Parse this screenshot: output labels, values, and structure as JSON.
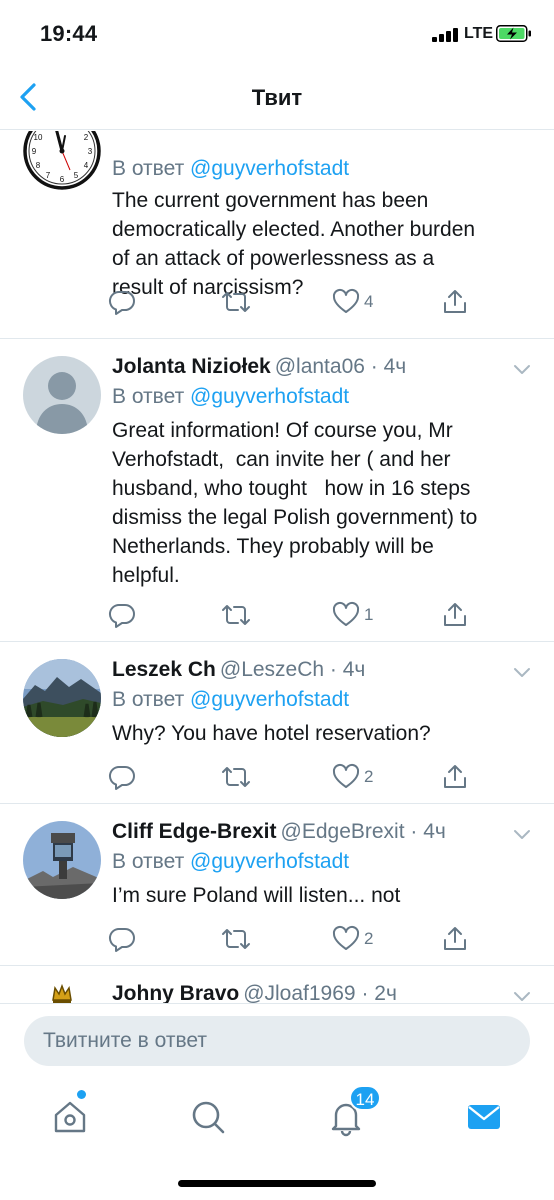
{
  "status_bar": {
    "time": "19:44",
    "network": "LTE"
  },
  "nav": {
    "title": "Твит"
  },
  "replying_prefix": "В ответ",
  "tweets": [
    {
      "name": "",
      "handle": "",
      "time": "",
      "mention": "@guyverhofstadt",
      "text": "The current government has been\ndemocratically elected. Another burden\nof an attack of powerlessness as a\nresult of narcissism?",
      "likes": "4",
      "avatar": "clock-avatar"
    },
    {
      "name": "Jolanta Niziołek",
      "handle": "@lanta06",
      "time": "4ч",
      "mention": "@guyverhofstadt",
      "text": "Great information! Of course you, Mr\nVerhofstadt,  can invite her ( and her\nhusband, who tought   how in 16 steps\ndismiss the legal Polish government) to\nNetherlands. They probably will be\nhelpful.",
      "likes": "1",
      "avatar": "default-avatar"
    },
    {
      "name": "Leszek Ch",
      "handle": "@LeszeCh",
      "time": "4ч",
      "mention": "@guyverhofstadt",
      "text": "Why? You have hotel reservation?",
      "likes": "2",
      "avatar": "mountain-avatar"
    },
    {
      "name": "Cliff Edge-Brexit",
      "handle": "@EdgeBrexit",
      "time": "4ч",
      "mention": "@guyverhofstadt",
      "text": "I’m sure Poland will listen... not",
      "likes": "2",
      "avatar": "cliff-avatar"
    },
    {
      "name": "Johny Bravo",
      "handle": "@Jloaf1969",
      "time": "2ч",
      "avatar": "crown-avatar"
    }
  ],
  "reply_bar": {
    "placeholder": "Твитните в ответ"
  },
  "tab_bar": {
    "notifications_count": "14"
  },
  "colors": {
    "accent": "#1da1f2",
    "muted": "#657786",
    "divider": "#e1e8ed"
  }
}
